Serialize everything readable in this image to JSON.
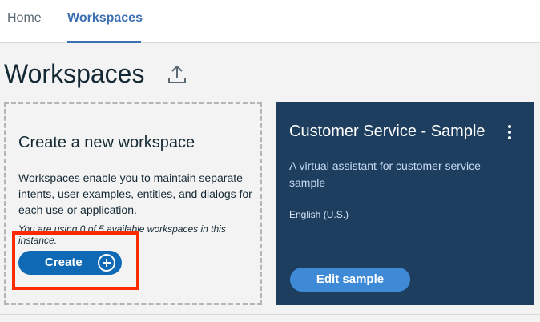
{
  "nav": {
    "tabs": [
      {
        "label": "Home",
        "active": false
      },
      {
        "label": "Workspaces",
        "active": true
      }
    ]
  },
  "page": {
    "title": "Workspaces",
    "upload_icon": "upload-icon"
  },
  "create_card": {
    "title": "Create a new workspace",
    "description": "Workspaces enable you to maintain separate intents, user examples, entities, and dialogs for each use or application.",
    "note": "You are using 0 of 5 available workspaces in this instance.",
    "button_label": "Create",
    "button_icon": "plus-circle-icon"
  },
  "sample_card": {
    "title": "Customer Service - Sample",
    "description": "A virtual assistant for customer service sample",
    "language": "English (U.S.)",
    "button_label": "Edit sample",
    "menu_icon": "overflow-menu-icon"
  },
  "colors": {
    "accent": "#3d70b2",
    "create_button": "#0f69b4",
    "sample_card_bg": "#1d3e5e",
    "edit_button": "#3e8ad6",
    "highlight": "#ff2a00"
  }
}
